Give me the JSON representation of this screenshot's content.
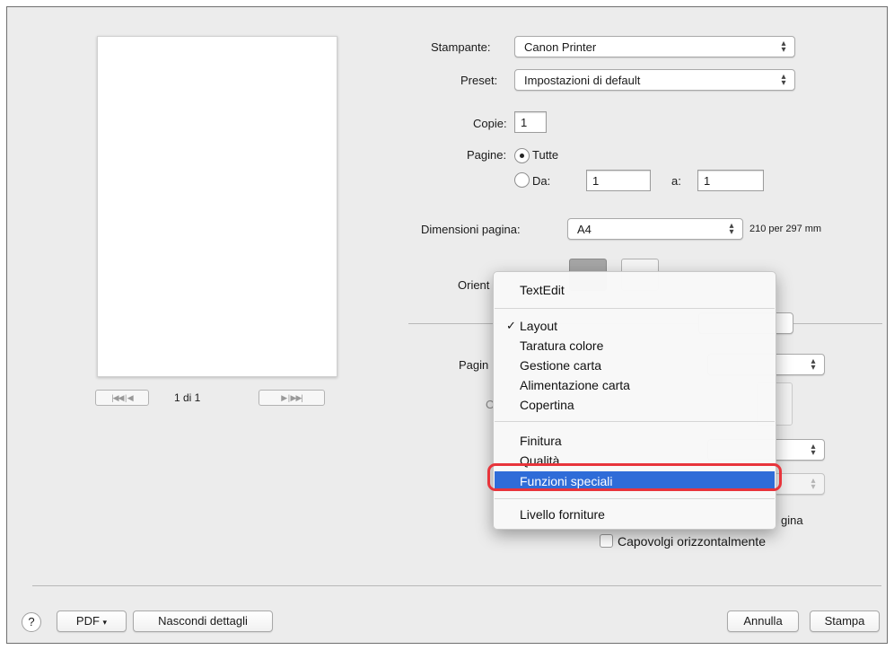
{
  "print_dialog": {
    "printer": {
      "label": "Stampante:",
      "value": "Canon Printer"
    },
    "preset": {
      "label": "Preset:",
      "value": "Impostazioni di default"
    },
    "copies": {
      "label": "Copie:",
      "value": "1"
    },
    "pages": {
      "label": "Pagine:",
      "all_label": "Tutte",
      "range_label": "Da:",
      "from_value": "1",
      "to_label": "a:",
      "to_value": "1",
      "selected": "all"
    },
    "paper_size": {
      "label": "Dimensioni pagina:",
      "value": "A4",
      "dimensions": "210 per 297 mm"
    },
    "orientation": {
      "label_visible": "Orient"
    },
    "pages_per_sheet": {
      "label_visible": "Pagin"
    },
    "layout_dir_label_visible": "O",
    "flip_horizontal": {
      "label": "Capovolgi orizzontalmente",
      "checked": false
    },
    "border_partial": "gina",
    "preview_nav": {
      "page_indicator": "1 di 1"
    },
    "footer": {
      "help": "?",
      "pdf": "PDF",
      "hide_details": "Nascondi dettagli",
      "cancel": "Annulla",
      "print": "Stampa"
    }
  },
  "panel_menu": {
    "items": [
      {
        "label": "TextEdit",
        "checked": false,
        "highlighted": false
      },
      {
        "label": "Layout",
        "checked": true,
        "highlighted": false
      },
      {
        "label": "Taratura colore",
        "checked": false,
        "highlighted": false
      },
      {
        "label": "Gestione carta",
        "checked": false,
        "highlighted": false
      },
      {
        "label": "Alimentazione carta",
        "checked": false,
        "highlighted": false
      },
      {
        "label": "Copertina",
        "checked": false,
        "highlighted": false
      },
      {
        "label": "Finitura",
        "checked": false,
        "highlighted": false
      },
      {
        "label": "Qualità",
        "checked": false,
        "highlighted": false
      },
      {
        "label": "Funzioni speciali",
        "checked": false,
        "highlighted": true
      },
      {
        "label": "Livello forniture",
        "checked": false,
        "highlighted": false
      }
    ],
    "check_glyph": "✓"
  },
  "colors": {
    "highlight": "#2f6cd8",
    "annotation_ring": "#e8343b",
    "dialog_bg": "#ececec"
  }
}
